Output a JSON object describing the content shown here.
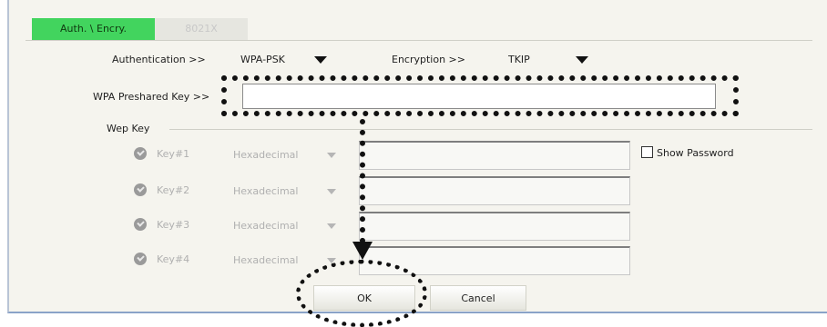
{
  "tabs": [
    {
      "label": "Auth. \\ Encry.",
      "active": true
    },
    {
      "label": "8021X",
      "active": false
    }
  ],
  "auth": {
    "label": "Authentication >>",
    "value": "WPA-PSK"
  },
  "encryption": {
    "label": "Encryption >>",
    "value": "TKIP"
  },
  "psk": {
    "label": "WPA Preshared Key >>",
    "value": ""
  },
  "wep": {
    "group_label": "Wep Key",
    "keys": [
      {
        "label": "Key#1",
        "format": "Hexadecimal",
        "value": ""
      },
      {
        "label": "Key#2",
        "format": "Hexadecimal",
        "value": ""
      },
      {
        "label": "Key#3",
        "format": "Hexadecimal",
        "value": ""
      },
      {
        "label": "Key#4",
        "format": "Hexadecimal",
        "value": ""
      }
    ]
  },
  "show_password": {
    "label": "Show Password",
    "checked": false
  },
  "buttons": {
    "ok": "OK",
    "cancel": "Cancel"
  },
  "colors": {
    "active_tab": "#42d45e",
    "panel": "#f5f4ee"
  }
}
